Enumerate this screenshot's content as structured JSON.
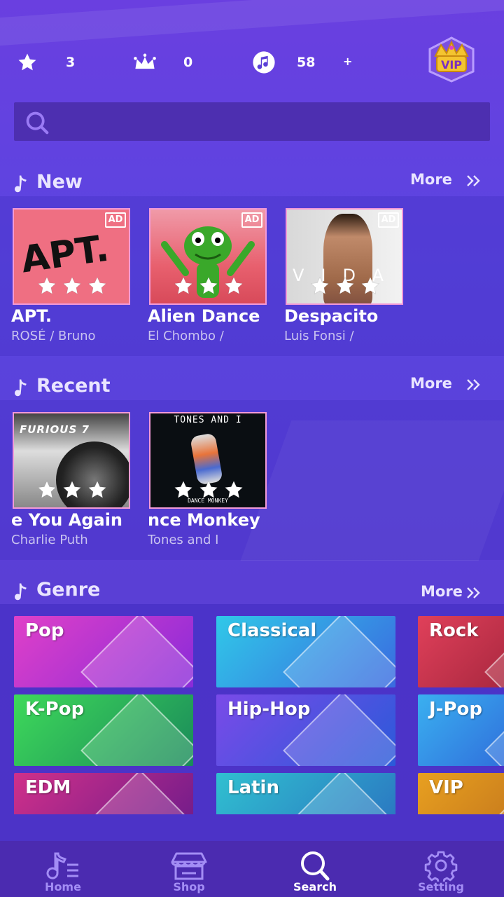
{
  "stats": {
    "stars": "3",
    "crowns": "0",
    "notes": "58",
    "plus": "+"
  },
  "vip_badge_text": "VIP",
  "search": {
    "placeholder": ""
  },
  "sections": {
    "new": {
      "title": "New",
      "more": "More"
    },
    "recent": {
      "title": "Recent",
      "more": "More"
    },
    "genre": {
      "title": "Genre",
      "more": "More"
    }
  },
  "new_songs": [
    {
      "title": "APT.",
      "artist": "ROSÉ / Bruno",
      "cover_text": "APT.",
      "ad": "AD",
      "stars": 3
    },
    {
      "title": "Alien Dance",
      "artist": "El Chombo /",
      "cover_text": "",
      "ad": "AD",
      "stars": 3
    },
    {
      "title": "Despacito",
      "artist": "Luis Fonsi /",
      "cover_text": "VIDA",
      "ad": "AD",
      "stars": 3
    }
  ],
  "recent_songs": [
    {
      "title": "e You Again",
      "artist": "Charlie Puth",
      "cover_text": "FURIOUS 7",
      "stars": 3
    },
    {
      "title": "nce Monkey",
      "artist": "Tones and I",
      "cover_text": "TONES AND I",
      "cover_sub": "DANCE MONKEY",
      "stars": 3
    }
  ],
  "genres": [
    {
      "label": "Pop",
      "color_a": "#e040c8",
      "color_b": "#8a2bd9"
    },
    {
      "label": "Classical",
      "color_a": "#30c8e8",
      "color_b": "#3a6ae0"
    },
    {
      "label": "Rock",
      "color_a": "#e0405a",
      "color_b": "#8a1a30"
    },
    {
      "label": "K-Pop",
      "color_a": "#3ed95a",
      "color_b": "#1a8a5a"
    },
    {
      "label": "Hip-Hop",
      "color_a": "#7a4ae8",
      "color_b": "#2a5ad9"
    },
    {
      "label": "J-Pop",
      "color_a": "#3ab0f0",
      "color_b": "#2a4ad0"
    },
    {
      "label": "EDM",
      "color_a": "#d0308a",
      "color_b": "#6a1a8a"
    },
    {
      "label": "Latin",
      "color_a": "#30c0d0",
      "color_b": "#2a70c0"
    },
    {
      "label": "VIP",
      "color_a": "#e8a020",
      "color_b": "#b0601a"
    }
  ],
  "tabs": [
    {
      "label": "Home",
      "icon": "music-list-icon",
      "active": false
    },
    {
      "label": "Shop",
      "icon": "shop-icon",
      "active": false
    },
    {
      "label": "Search",
      "icon": "search-icon",
      "active": true
    },
    {
      "label": "Setting",
      "icon": "gear-icon",
      "active": false
    }
  ]
}
